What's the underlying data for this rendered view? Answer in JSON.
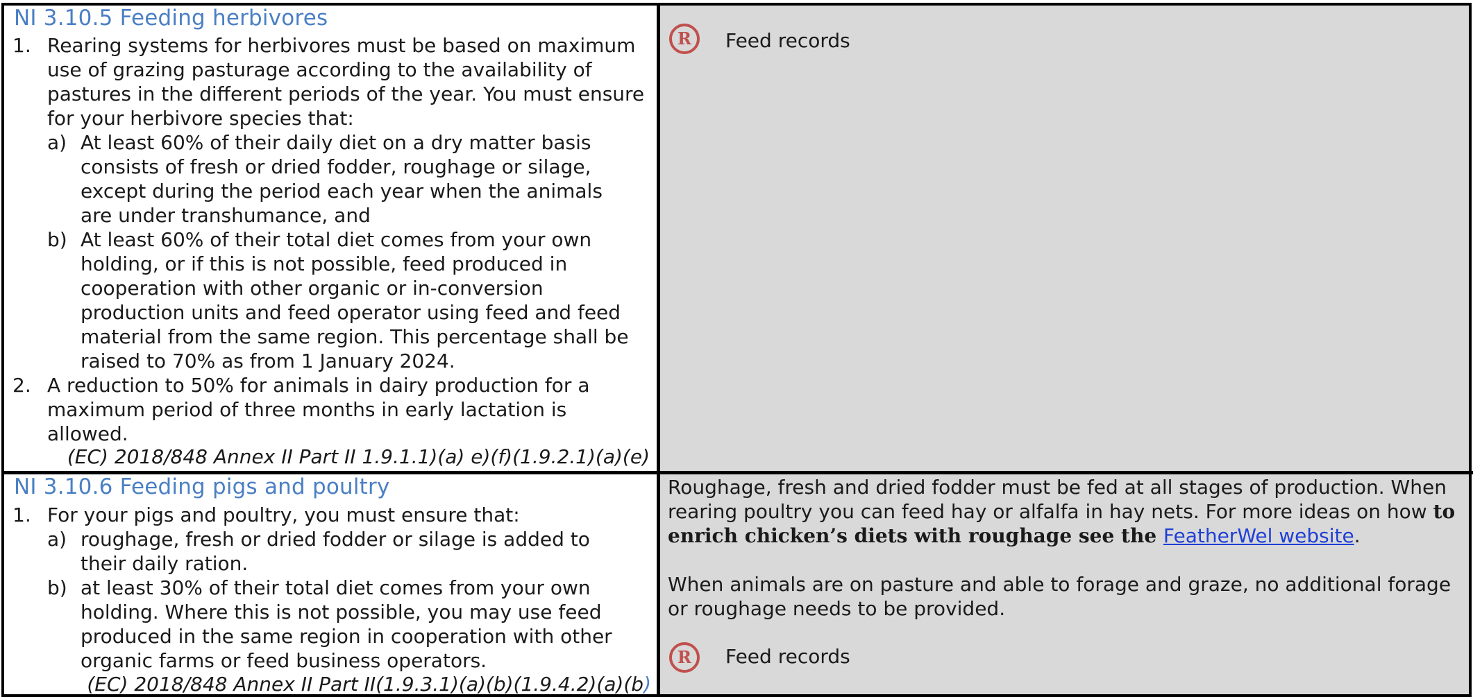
{
  "sections": [
    {
      "title": "NI 3.10.5 Feeding herbivores",
      "items": [
        {
          "num": "1.",
          "text": "Rearing systems for herbivores must be based on maximum use of grazing pasturage according to the availability of pastures in the different periods of the year. You must ensure for your herbivore species that:",
          "subitems": [
            {
              "label": "a)",
              "text": "At least 60% of their daily diet on a dry matter basis consists of fresh or dried fodder, roughage or silage, except during the period each year when the animals are under transhumance, and"
            },
            {
              "label": "b)",
              "text": "At least 60% of their total diet comes from your own holding, or if this is not possible, feed produced in cooperation with other organic or in-conversion production units and feed operator using feed and feed material from the same region. This percentage shall be raised to 70% as from 1 January 2024."
            }
          ]
        },
        {
          "num": "2.",
          "text": "A reduction to 50% for animals in dairy production for a maximum period of three months in early lactation is allowed."
        }
      ],
      "citation": "(EC) 2018/848 Annex II Part II 1.9.1.1)(a) e)(f)(1.9.2.1)(a)(e)",
      "guidance": {
        "record_label": "Feed records"
      }
    },
    {
      "title": "NI 3.10.6 Feeding pigs and poultry",
      "items": [
        {
          "num": "1.",
          "text": "For your pigs and poultry, you must ensure that:",
          "subitems": [
            {
              "label": "a)",
              "text": "roughage, fresh or dried fodder or silage is added to their daily ration."
            },
            {
              "label": "b)",
              "text": "at least 30% of their total diet comes from your own holding. Where this is not possible, you may use feed produced in the same region in cooperation with other organic farms or feed business operators."
            }
          ]
        }
      ],
      "citation": "(EC) 2018/848 Annex II Part II(1.9.3.1)(a)(b)(1.9.4.2)(a)(b",
      "citation_end": ")",
      "guidance": {
        "para1_plain": "Roughage, fresh and dried fodder must be fed at all stages of production. When rearing poultry you can feed hay or alfalfa in hay nets. For more ideas on how ",
        "para1_bold": "to enrich chicken’s diets with roughage see the ",
        "para1_link": "FeatherWel website",
        "para1_end": ".",
        "para2": "When animals are on pasture and able to forage and graze, no additional forage or roughage needs to be provided.",
        "record_label": "Feed records"
      }
    }
  ],
  "icons": {
    "record": "registered-r-icon",
    "record_color": "#c0504d"
  }
}
